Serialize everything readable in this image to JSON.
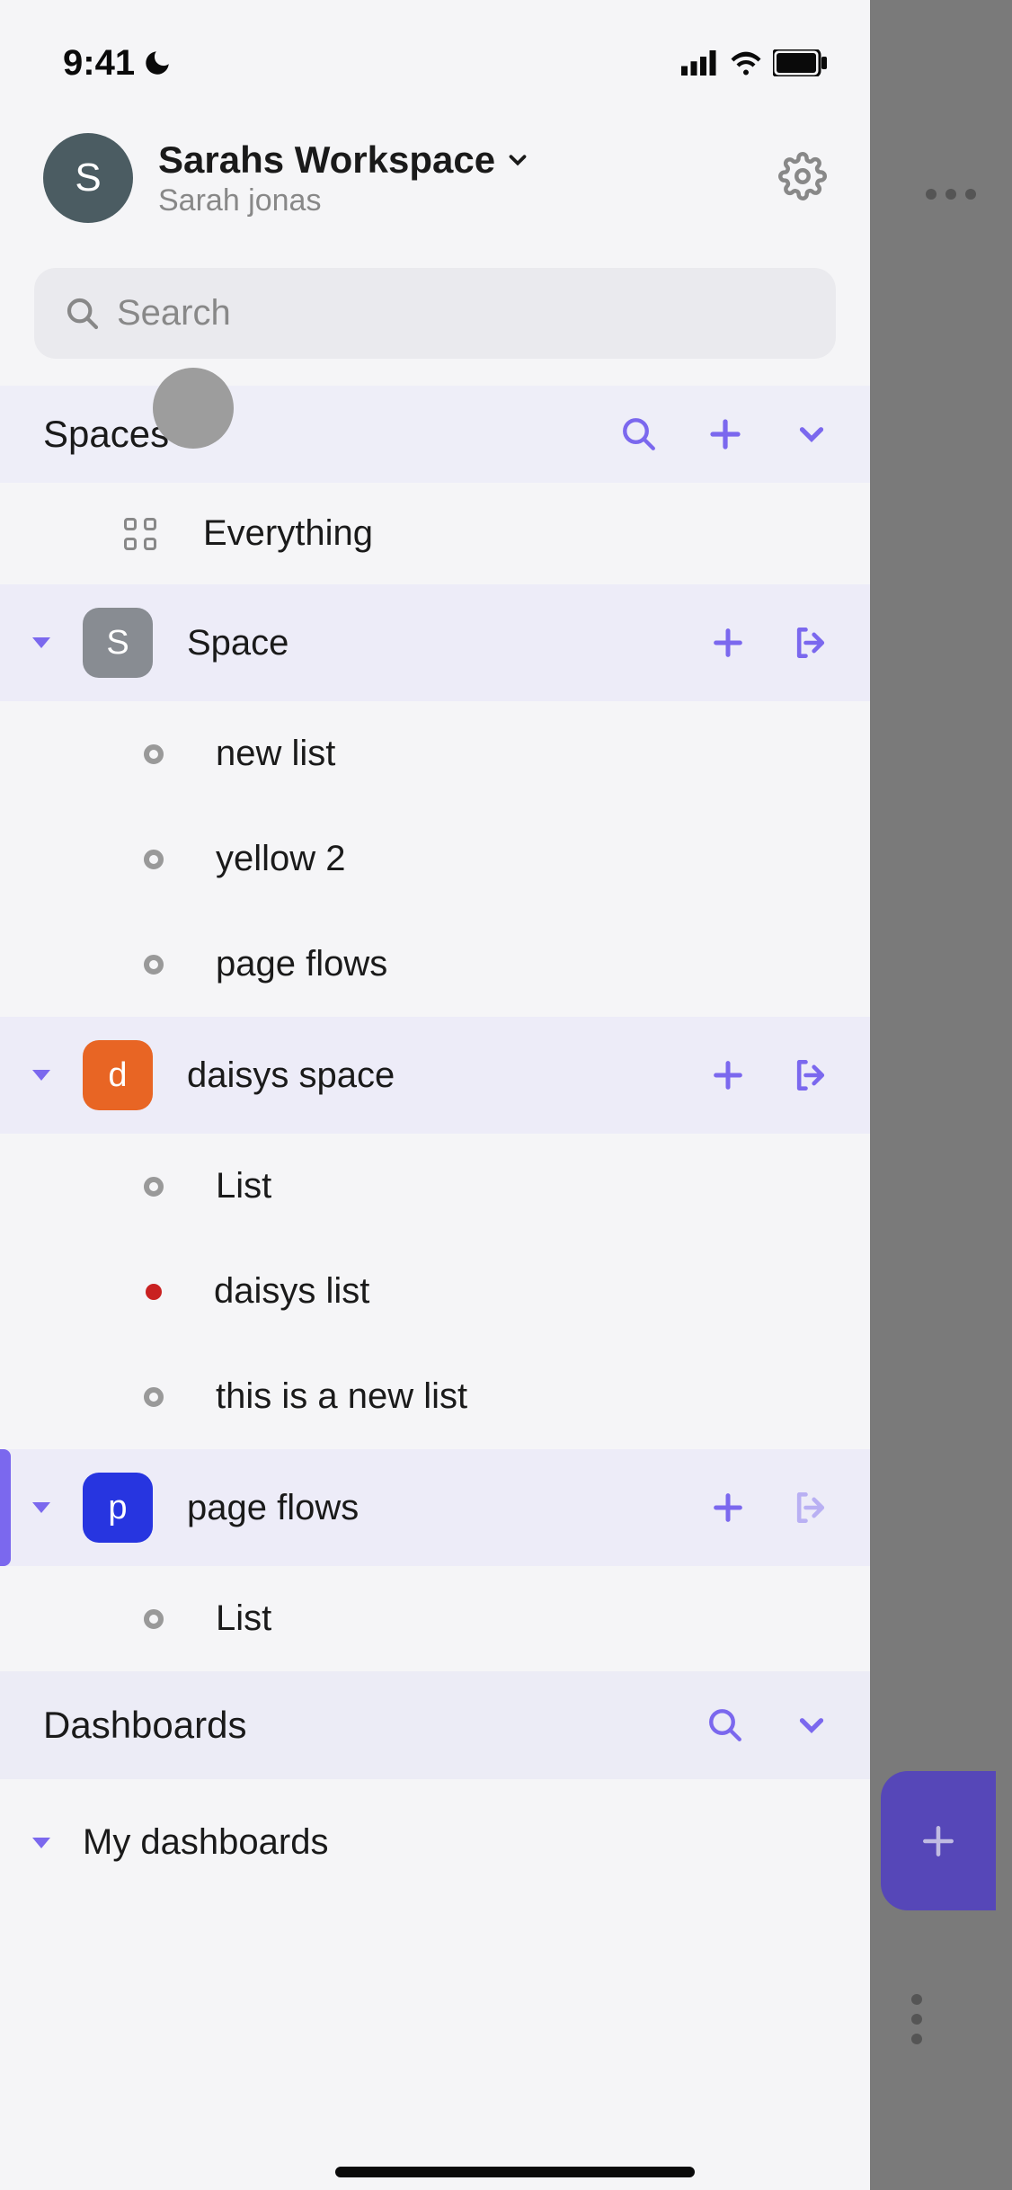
{
  "status": {
    "time": "9:41"
  },
  "header": {
    "avatar_letter": "S",
    "workspace_name": "Sarahs Workspace",
    "username": "Sarah jonas"
  },
  "search": {
    "placeholder": "Search"
  },
  "sections": {
    "spaces": {
      "title": "Spaces",
      "everything": "Everything",
      "items": [
        {
          "letter": "S",
          "name": "Space",
          "color": "#888c92",
          "lists": [
            "new list",
            "yellow 2",
            "page flows"
          ]
        },
        {
          "letter": "d",
          "name": "daisys space",
          "color": "#e86524",
          "lists": [
            "List",
            "daisys list",
            "this is a new list"
          ]
        },
        {
          "letter": "p",
          "name": "page flows",
          "color": "#2735e0",
          "active": true,
          "lists": [
            "List"
          ]
        }
      ]
    },
    "dashboards": {
      "title": "Dashboards",
      "my_dashboards": "My dashboards"
    }
  },
  "colors": {
    "accent": "#7b68ee"
  }
}
